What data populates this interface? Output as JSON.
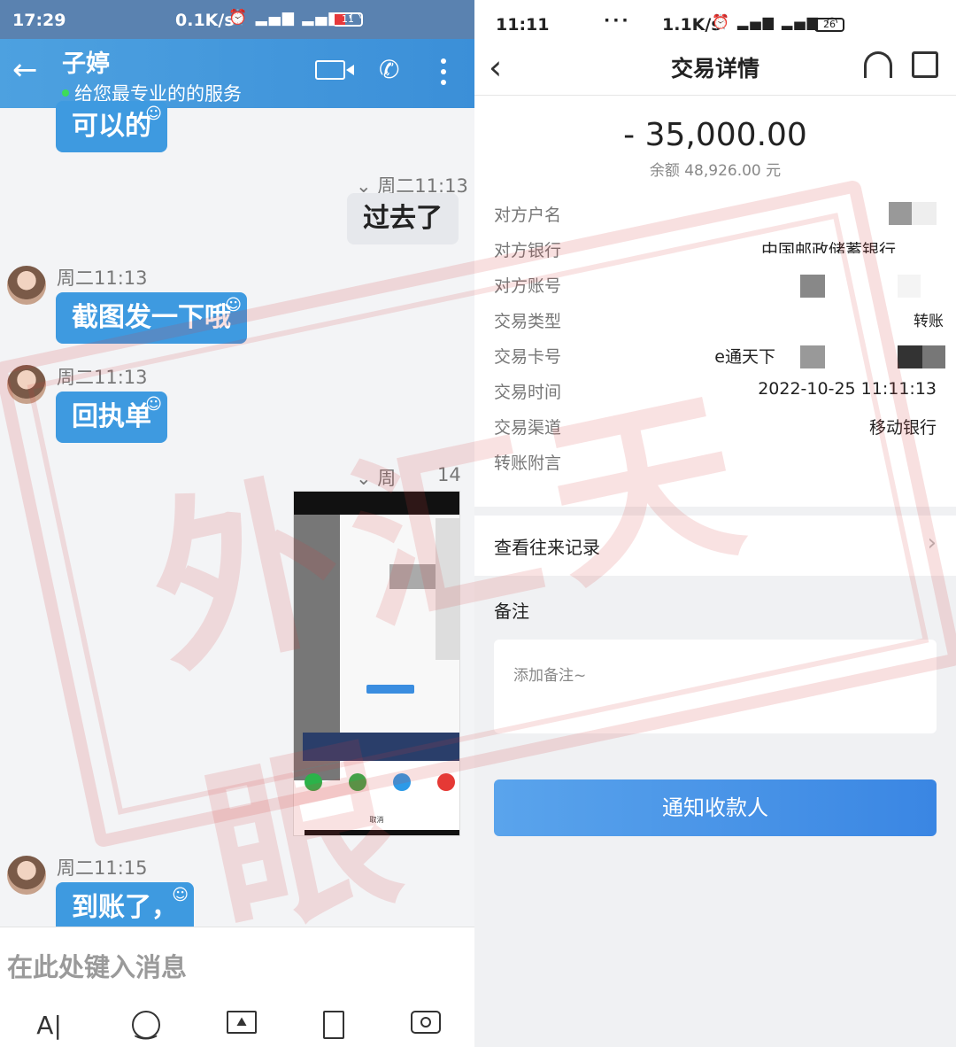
{
  "chat": {
    "status": {
      "time": "17:29",
      "net": "0.1K/s",
      "battery": "11"
    },
    "header": {
      "back": "←",
      "name": "子婷",
      "subtitle": "给您最专业的的服务"
    },
    "messages": [
      {
        "side": "left",
        "text": "可以的",
        "smile": "☺"
      },
      {
        "side": "right",
        "time": "周二11:13",
        "text": "过去了"
      },
      {
        "side": "left",
        "time": "周二11:13",
        "text": "截图发一下哦",
        "smile": "☺"
      },
      {
        "side": "left",
        "time": "周二11:13",
        "text": "回执单",
        "smile": "☺"
      },
      {
        "side": "right",
        "time_a": "周",
        "time_b": "14"
      },
      {
        "side": "left",
        "time": "周二11:15",
        "text": "到账了，",
        "smile": "☺"
      }
    ],
    "screenshot_thumb": {
      "cancel": "取消",
      "notify": "通知收款人"
    },
    "input": {
      "placeholder": "在此处键入消息"
    },
    "tools": {
      "text": "A|",
      "smile": "☺"
    }
  },
  "bank": {
    "status": {
      "time": "11:11",
      "dots": "···",
      "net": "1.1K/s",
      "battery": "26"
    },
    "header": {
      "back": "‹",
      "title": "交易详情"
    },
    "amount": "- 35,000.00",
    "balance": "余额 48,926.00 元",
    "rows": [
      {
        "k": "对方户名",
        "v": ""
      },
      {
        "k": "对方银行",
        "v": "中国邮政储蓄银行"
      },
      {
        "k": "对方账号",
        "v": ""
      },
      {
        "k": "交易类型",
        "v": "转账"
      },
      {
        "k": "交易卡号",
        "v": "e通天下"
      },
      {
        "k": "交易时间",
        "v": "2022-10-25 11:11:13"
      },
      {
        "k": "交易渠道",
        "v": "移动银行"
      },
      {
        "k": "转账附言",
        "v": ""
      }
    ],
    "history": "查看往来记录",
    "chevron": "›",
    "note_title": "备注",
    "note_placeholder": "添加备注~",
    "notify_button": "通知收款人"
  },
  "watermark": "外汇天眼",
  "colors": {
    "chat_accent": "#3e9ae0",
    "bank_button": "#3a86e3",
    "watermark": "#d63c3c"
  }
}
